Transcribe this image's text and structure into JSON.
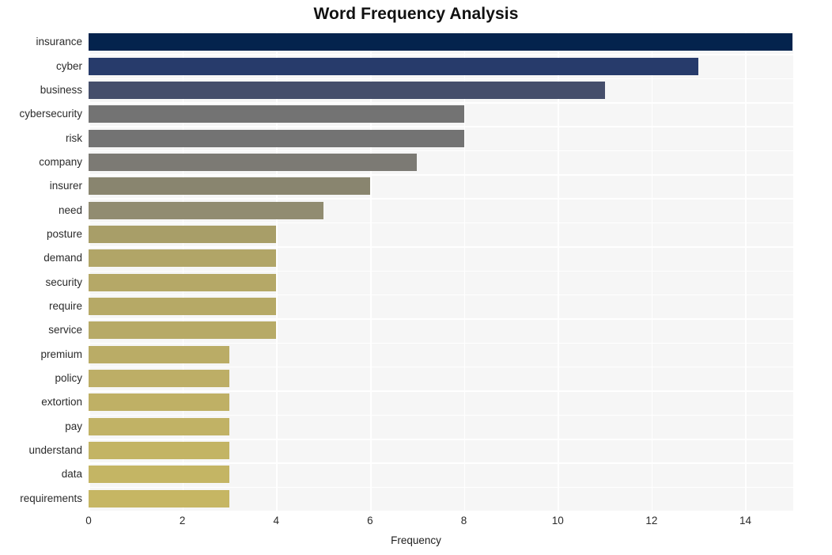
{
  "chart_data": {
    "type": "bar",
    "orientation": "horizontal",
    "title": "Word Frequency Analysis",
    "xlabel": "Frequency",
    "ylabel": "",
    "categories": [
      "insurance",
      "cyber",
      "business",
      "cybersecurity",
      "risk",
      "company",
      "insurer",
      "need",
      "posture",
      "demand",
      "security",
      "require",
      "service",
      "premium",
      "policy",
      "extortion",
      "pay",
      "understand",
      "data",
      "requirements"
    ],
    "values": [
      15,
      13,
      11,
      8,
      8,
      7,
      6,
      5,
      4,
      4,
      4,
      4,
      4,
      3,
      3,
      3,
      3,
      3,
      3,
      3
    ],
    "bar_colors": [
      "#04234d",
      "#273b6b",
      "#454e6b",
      "#737373",
      "#737373",
      "#7c7a74",
      "#898madjust",
      "#918c71",
      "#b5a867",
      "#b5a867",
      "#b5a867",
      "#b5a867",
      "#b5a867",
      "#bdae66",
      "#bdae66",
      "#bdae66",
      "#bdae66",
      "#bdae66",
      "#bdae66",
      "#c6b663"
    ],
    "xticks": [
      0,
      2,
      4,
      6,
      8,
      10,
      12,
      14
    ],
    "xlim": [
      0,
      15.02
    ],
    "grid": true,
    "grid_color": "#ffffff",
    "plot_background": "#f6f6f6",
    "figure_background": "#ffffff",
    "legend": null
  }
}
